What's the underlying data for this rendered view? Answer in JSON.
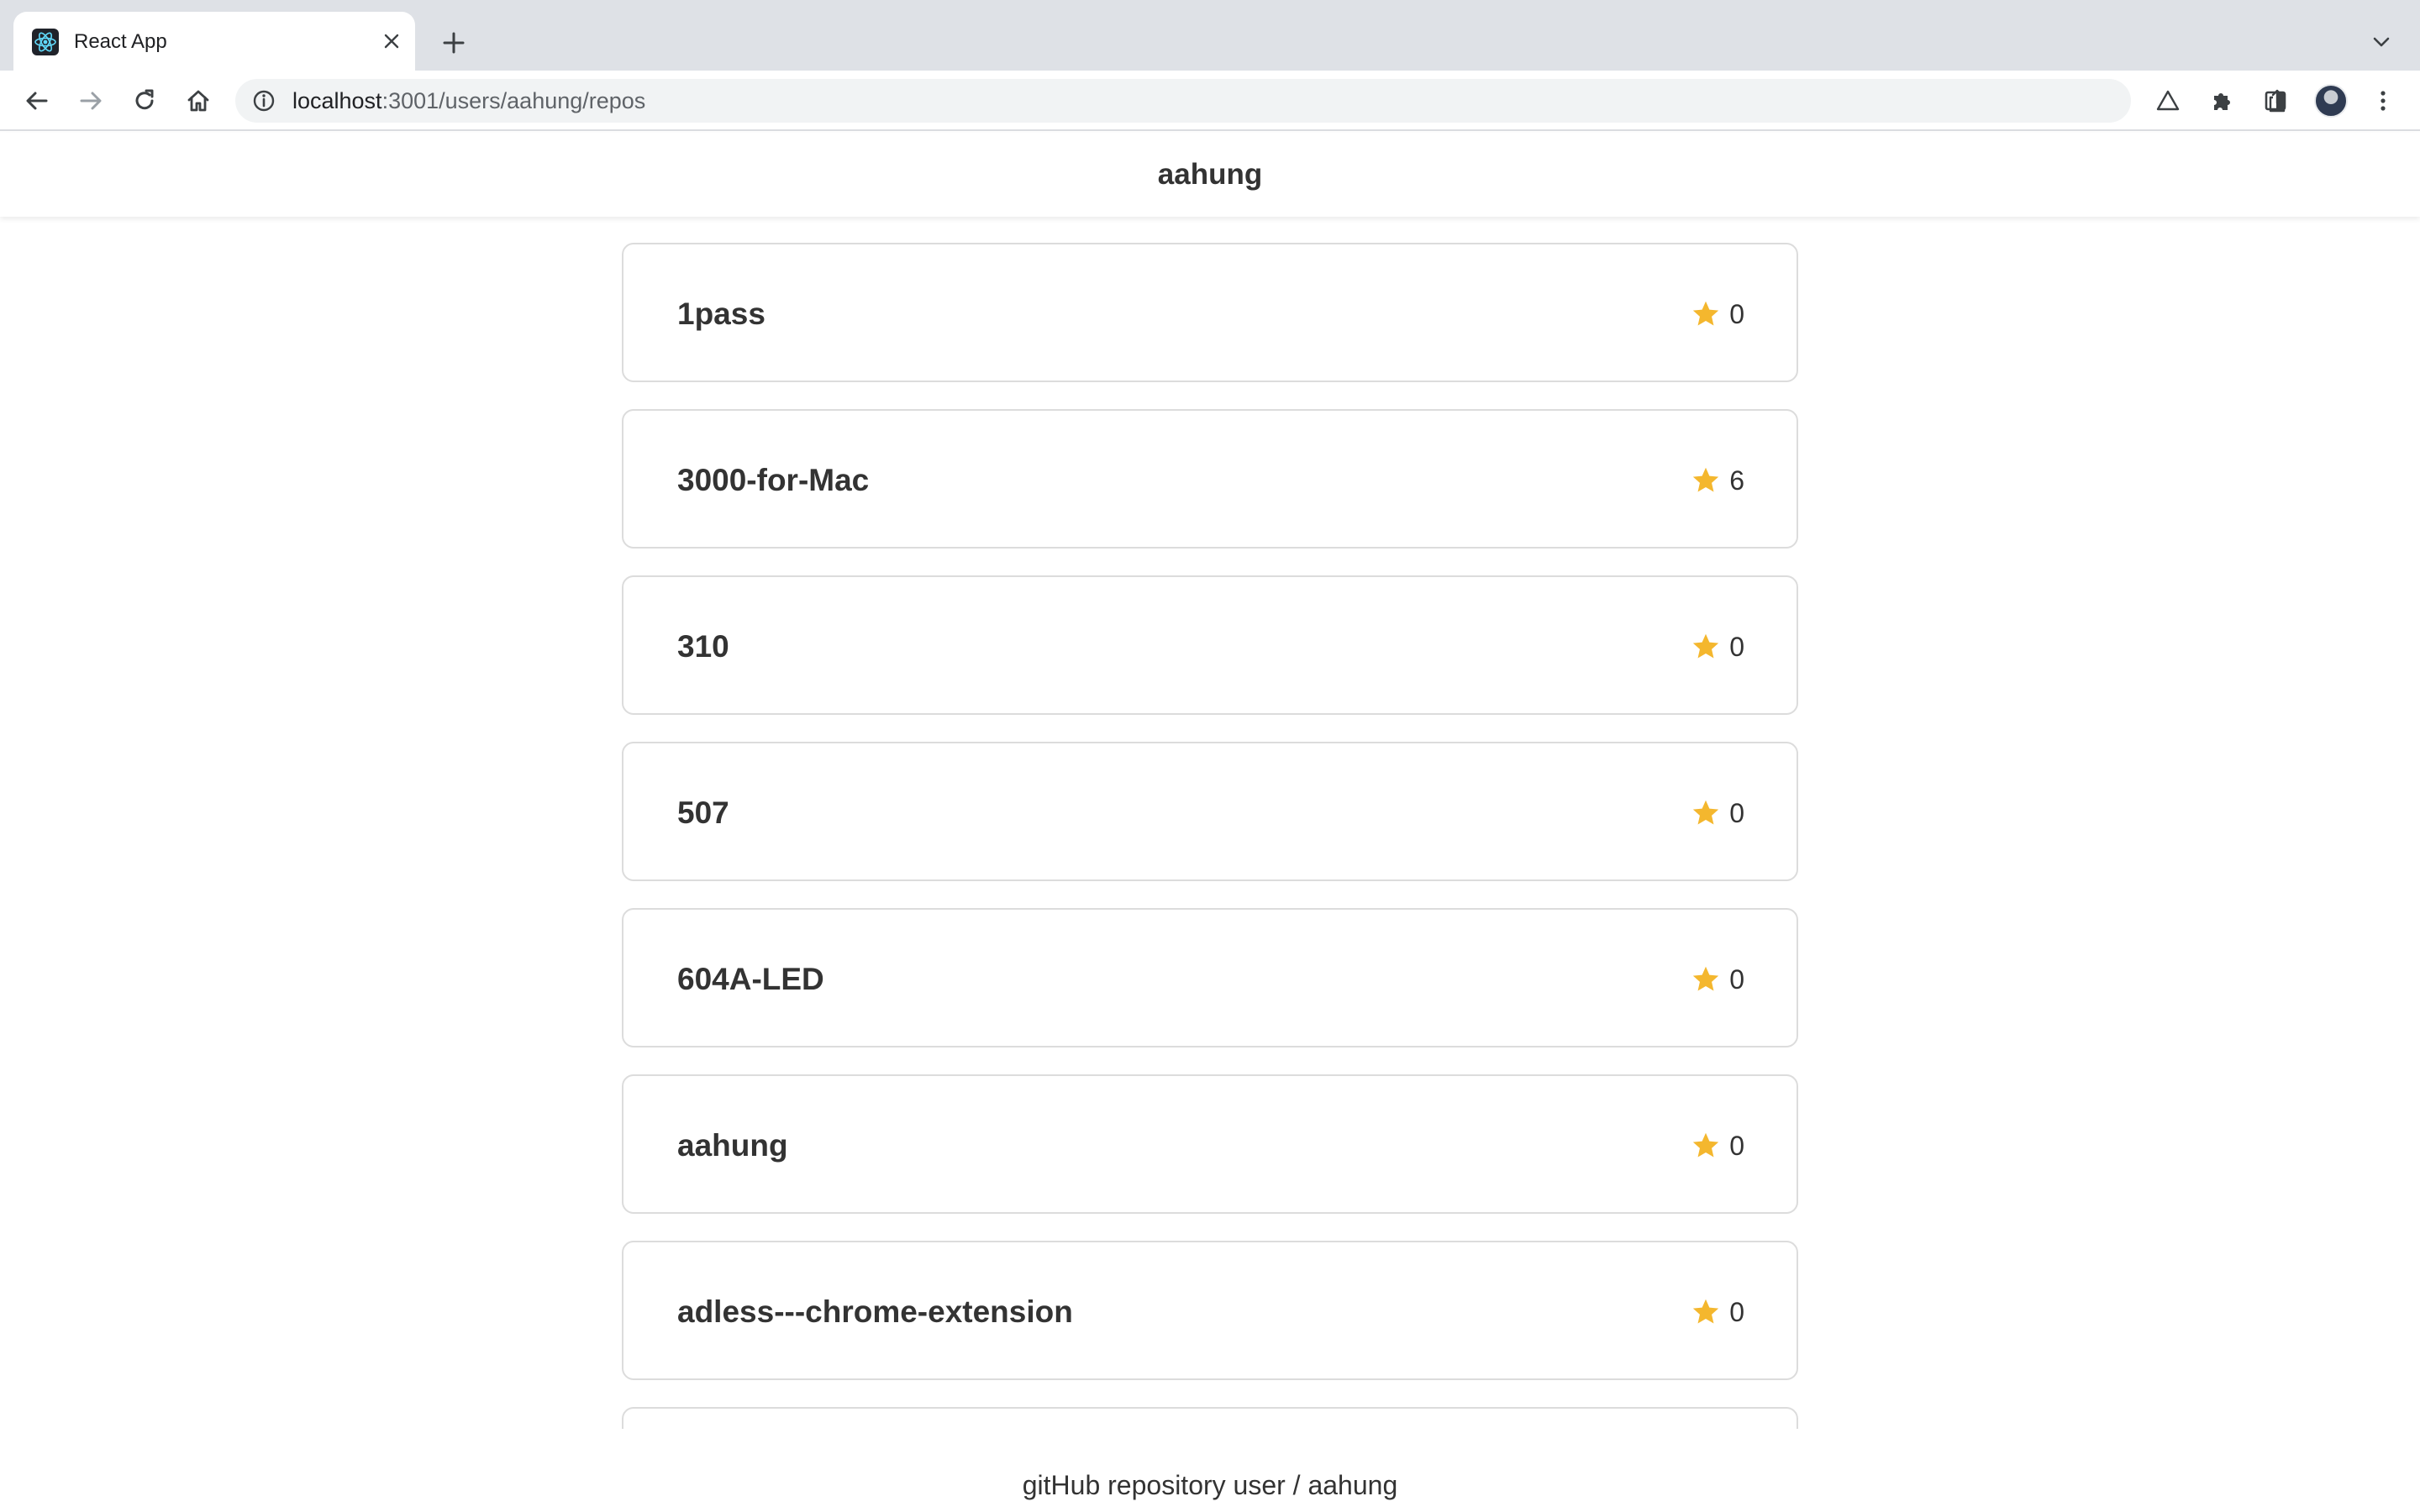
{
  "browser": {
    "tab": {
      "title": "React App",
      "favicon": "react-logo-icon"
    },
    "address": {
      "host": "localhost",
      "path": ":3001/users/aahung/repos"
    },
    "icons": [
      "back-icon",
      "forward-icon",
      "reload-icon",
      "home-icon",
      "info-icon",
      "share-icon",
      "bookmark-star-icon",
      "drive-icon",
      "extensions-icon",
      "side-panel-icon",
      "avatar",
      "menu-icon"
    ]
  },
  "header": {
    "title": "aahung"
  },
  "repos": [
    {
      "name": "1pass",
      "stars": "0"
    },
    {
      "name": "3000-for-Mac",
      "stars": "6"
    },
    {
      "name": "310",
      "stars": "0"
    },
    {
      "name": "507",
      "stars": "0"
    },
    {
      "name": "604A-LED",
      "stars": "0"
    },
    {
      "name": "aahung",
      "stars": "0"
    },
    {
      "name": "adless---chrome-extension",
      "stars": "0"
    },
    {
      "name": "",
      "stars": ""
    }
  ],
  "colors": {
    "star": "#f4b72e",
    "card_border": "#dcdcdc",
    "text": "#333333"
  },
  "footer": {
    "text": "gitHub repository user / aahung"
  }
}
